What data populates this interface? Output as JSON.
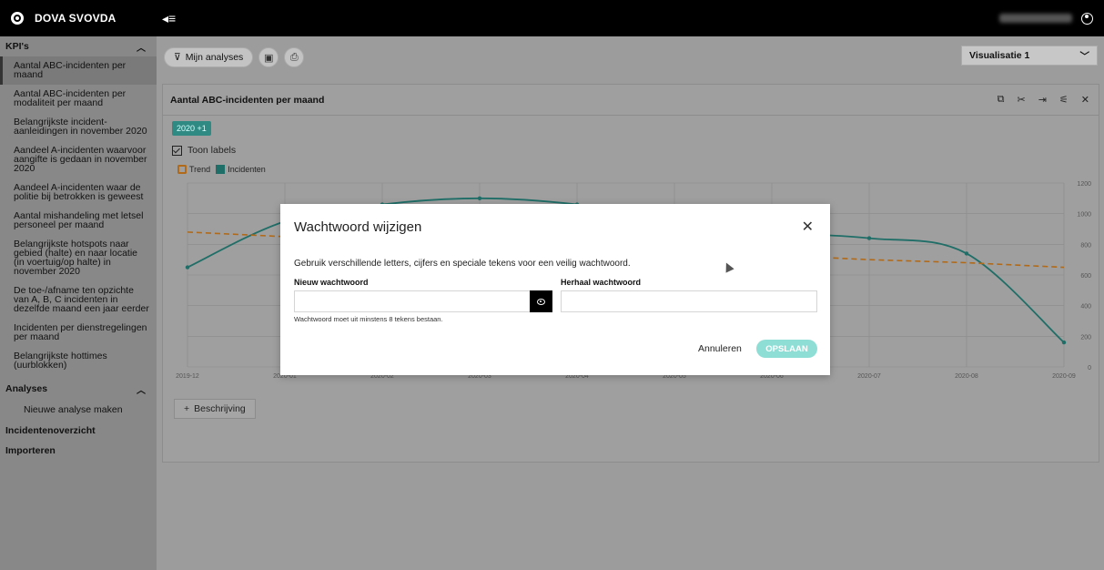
{
  "brand": {
    "name": "DOVA SVOVDA"
  },
  "sidebar": {
    "kpis_label": "KPI's",
    "kpis": [
      "Aantal ABC-incidenten per maand",
      "Aantal ABC-incidenten per modaliteit per maand",
      "Belangrijkste incident-aanleidingen in november 2020",
      "Aandeel A-incidenten waarvoor aangifte is gedaan in november 2020",
      "Aandeel A-incidenten waar de politie bij betrokken is geweest",
      "Aantal mishandeling met letsel personeel per maand",
      "Belangrijkste hotspots naar gebied (halte) en naar locatie (in voertuig/op halte) in november 2020",
      "De toe-/afname ten opzichte van A, B, C incidenten in dezelfde maand een jaar eerder",
      "Incidenten per dienstregelingen per maand",
      "Belangrijkste hottimes (uurblokken)"
    ],
    "analyses_label": "Analyses",
    "new_analysis": "Nieuwe analyse maken",
    "incident_overview": "Incidentenoverzicht",
    "import": "Importeren"
  },
  "toolbar": {
    "my_analyses": "Mijn analyses"
  },
  "visualisation": {
    "selected": "Visualisatie 1"
  },
  "card": {
    "title": "Aantal ABC-incidenten per maand",
    "badge": "2020 +1",
    "show_labels": "Toon labels",
    "legend_trend": "Trend",
    "legend_incidents": "Incidenten",
    "description_button": "Beschrijving"
  },
  "chart_data": {
    "type": "line",
    "x": [
      "2019-12",
      "2020-01",
      "2020-02",
      "2020-03",
      "2020-04",
      "2020-05",
      "2020-06",
      "2020-07",
      "2020-08",
      "2020-09"
    ],
    "series": [
      {
        "name": "Incidenten",
        "values": [
          650,
          950,
          1060,
          1100,
          1060,
          960,
          880,
          840,
          740,
          160
        ]
      },
      {
        "name": "Trend",
        "values": [
          880,
          850,
          830,
          810,
          790,
          760,
          730,
          700,
          680,
          650
        ]
      }
    ],
    "yticks": [
      "0",
      "200",
      "400",
      "600",
      "800",
      "1000",
      "1200"
    ],
    "ylim": [
      0,
      1200
    ],
    "colors": {
      "incidents": "#1f6e67",
      "trend": "#b06a1a"
    }
  },
  "modal": {
    "title": "Wachtwoord wijzigen",
    "description": "Gebruik verschillende letters, cijfers en speciale tekens voor een veilig wachtwoord.",
    "new_password_label": "Nieuw wachtwoord",
    "repeat_password_label": "Herhaal wachtwoord",
    "new_password_value": "",
    "repeat_password_value": "",
    "hint": "Wachtwoord moet uit minstens 8 tekens bestaan.",
    "cancel": "Annuleren",
    "save": "OPSLAAN"
  }
}
